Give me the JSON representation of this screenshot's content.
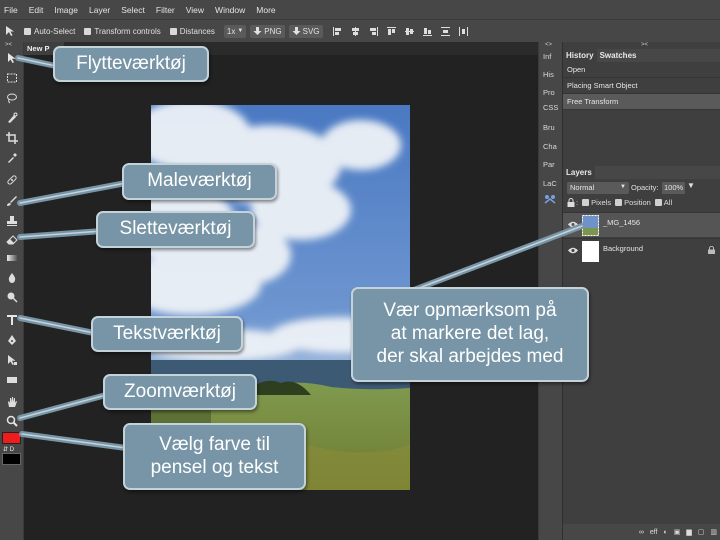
{
  "menubar": {
    "items": [
      "File",
      "Edit",
      "Image",
      "Layer",
      "Select",
      "Filter",
      "View",
      "Window",
      "More"
    ]
  },
  "options": {
    "auto_select": "Auto-Select",
    "transform_controls": "Transform controls",
    "distances": "Distances",
    "zoom": "1x",
    "png_label": "PNG",
    "svg_label": "SVG"
  },
  "document": {
    "tab_title": "New P"
  },
  "mini_panels": [
    "Inf",
    "His",
    "Pro",
    "CSS",
    "Bru",
    "Cha",
    "Par",
    "LaC"
  ],
  "history": {
    "tab": "History",
    "swatches_tab": "Swatches",
    "items": [
      "Open",
      "Placing Smart Object",
      "Free Transform"
    ]
  },
  "layers": {
    "tab": "Layers",
    "blend_mode": "Normal",
    "opacity_label": "Opacity:",
    "opacity_value": "100%",
    "lock_label": "",
    "pixels": "Pixels",
    "position": "Position",
    "all": "All",
    "items": [
      {
        "name": "_MG_1456"
      },
      {
        "name": "Background"
      }
    ],
    "footer_eff": "eff"
  },
  "callouts": {
    "move_tool": "Flytteværktøj",
    "paint_tool": "Maleværktøj",
    "eraser_tool": "Sletteværktøj",
    "text_tool": "Tekstværktøj",
    "zoom_tool": "Zoomværktøj",
    "color_line1": "Vælg farve til",
    "color_line2": "pensel og tekst",
    "layer_line1": "Vær opmærksom på",
    "layer_line2": "at markere det lag,",
    "layer_line3": "der skal arbejdes med"
  },
  "colors": {
    "callout_bg": "#7795a6",
    "callout_border": "#c4d2da",
    "foreground_color": "#ee1c1c",
    "background_color": "#000000"
  }
}
